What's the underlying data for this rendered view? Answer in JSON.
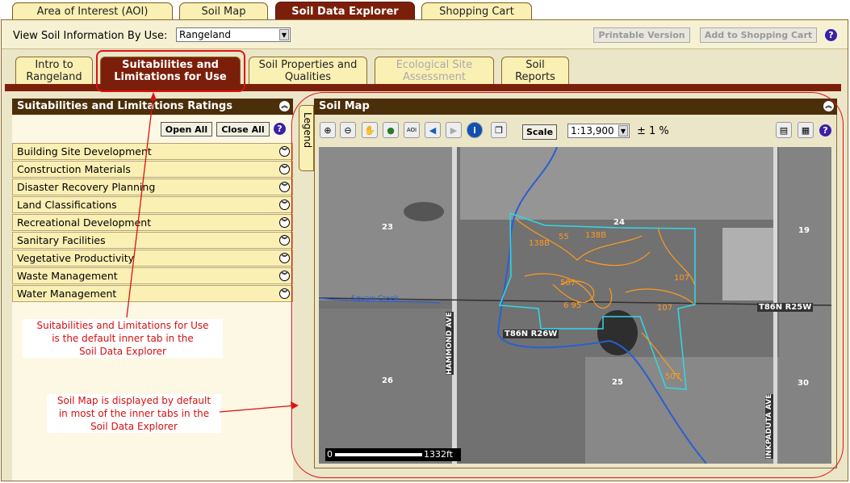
{
  "top_tabs": [
    "Area of Interest (AOI)",
    "Soil Map",
    "Soil Data Explorer",
    "Shopping Cart"
  ],
  "toolbar": {
    "view_label": "View Soil Information By Use:",
    "use_value": "Rangeland",
    "printable": "Printable Version",
    "add_cart": "Add to Shopping Cart",
    "help": "?"
  },
  "inner_tabs": [
    {
      "line1": "Intro to",
      "line2": "Rangeland"
    },
    {
      "line1": "Suitabilities and",
      "line2": "Limitations for Use"
    },
    {
      "line1": "Soil Properties and",
      "line2": "Qualities"
    },
    {
      "line1": "Ecological Site",
      "line2": "Assessment"
    },
    {
      "line1": "Soil",
      "line2": "Reports"
    }
  ],
  "left_panel": {
    "title": "Suitabilities and Limitations Ratings",
    "open_all": "Open All",
    "close_all": "Close All",
    "categories": [
      "Building Site Development",
      "Construction Materials",
      "Disaster Recovery Planning",
      "Land Classifications",
      "Recreational Development",
      "Sanitary Facilities",
      "Vegetative Productivity",
      "Waste Management",
      "Water Management"
    ]
  },
  "notes": {
    "note1": [
      "Suitabilities and Limitations for Use",
      "is the default inner tab in the",
      "Soil Data Explorer"
    ],
    "note2": [
      "Soil Map is displayed by default",
      "in most of the inner tabs in the",
      "Soil Data Explorer"
    ]
  },
  "map": {
    "title": "Soil Map",
    "legend": "Legend",
    "scale_btn": "Scale",
    "scale_value": "1:13,900",
    "precision": "± 1 %",
    "scalebar_start": "0",
    "scalebar_end": "1332ft",
    "labels": {
      "sec23": "23",
      "sec24": "24",
      "sec19": "19",
      "sec26": "26",
      "sec25": "25",
      "sec30": "30",
      "road1": "HAMMOND AVE",
      "road2": "INKPADUTA AVE",
      "twp1": "T86N R26W",
      "twp2": "T86N R25W",
      "creek": "Squaw Creek",
      "u1": "138B",
      "u2": "55",
      "u3": "138B",
      "u4": "507",
      "u5": "107",
      "u6": "6 95",
      "u7": "107",
      "u8": "507"
    }
  }
}
